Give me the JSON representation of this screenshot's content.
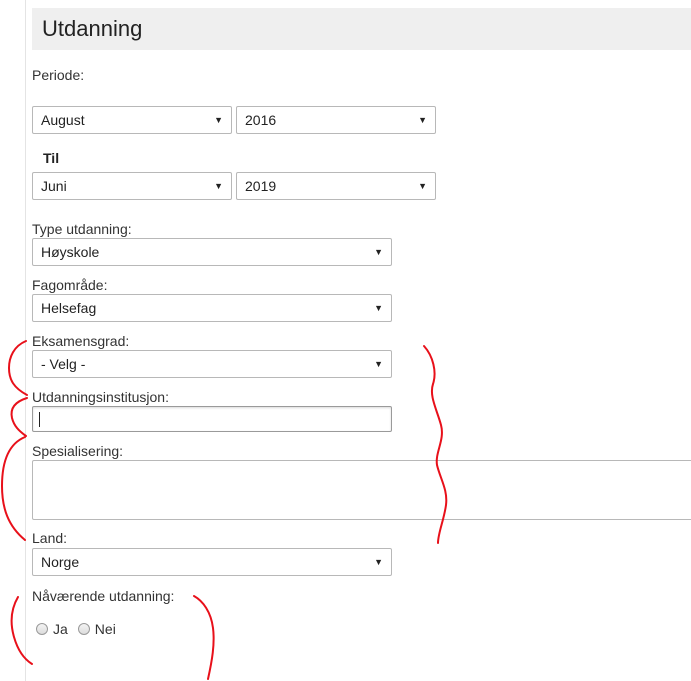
{
  "section": {
    "title": "Utdanning"
  },
  "period": {
    "label": "Periode:",
    "from_month": "August",
    "from_year": "2016",
    "til_label": "Til",
    "to_month": "Juni",
    "to_year": "2019"
  },
  "education_type": {
    "label": "Type utdanning:",
    "value": "Høyskole"
  },
  "field": {
    "label": "Fagområde:",
    "value": "Helsefag"
  },
  "degree": {
    "label": "Eksamensgrad:",
    "value": "- Velg -"
  },
  "institution": {
    "label": "Utdanningsinstitusjon:",
    "value": ""
  },
  "specialization": {
    "label": "Spesialisering:",
    "value": ""
  },
  "country": {
    "label": "Land:",
    "value": "Norge"
  },
  "current": {
    "label": "Nåværende utdanning:",
    "options": [
      {
        "label": "Ja"
      },
      {
        "label": "Nei"
      }
    ]
  },
  "annotation_color": "#e8101a",
  "icons": {
    "dropdown": "▼"
  }
}
